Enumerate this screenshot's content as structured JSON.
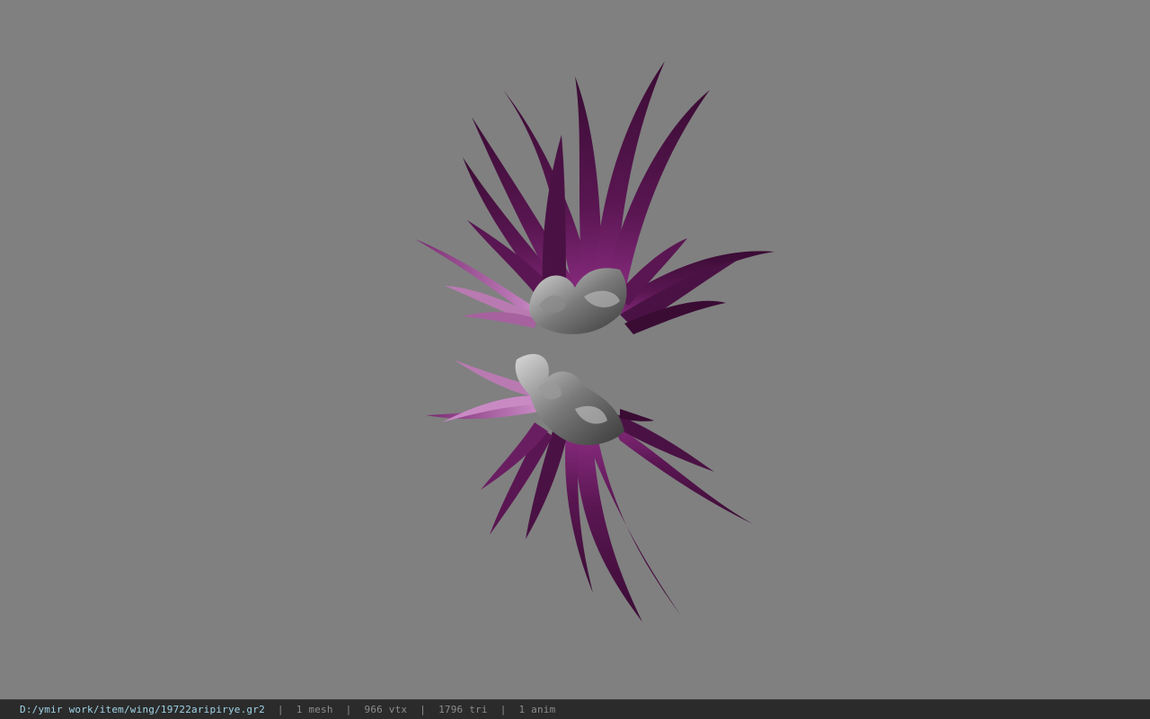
{
  "viewer": {
    "background_color": "#808080",
    "model_icon": "wing-model"
  },
  "statusbar": {
    "file_path": "D:/ymir work/item/wing/19722aripirye.gr2",
    "separator": "|",
    "mesh_count": "1 mesh",
    "vertex_count": "966 vtx",
    "triangle_count": "1796 tri",
    "anim_count": "1 anim"
  }
}
